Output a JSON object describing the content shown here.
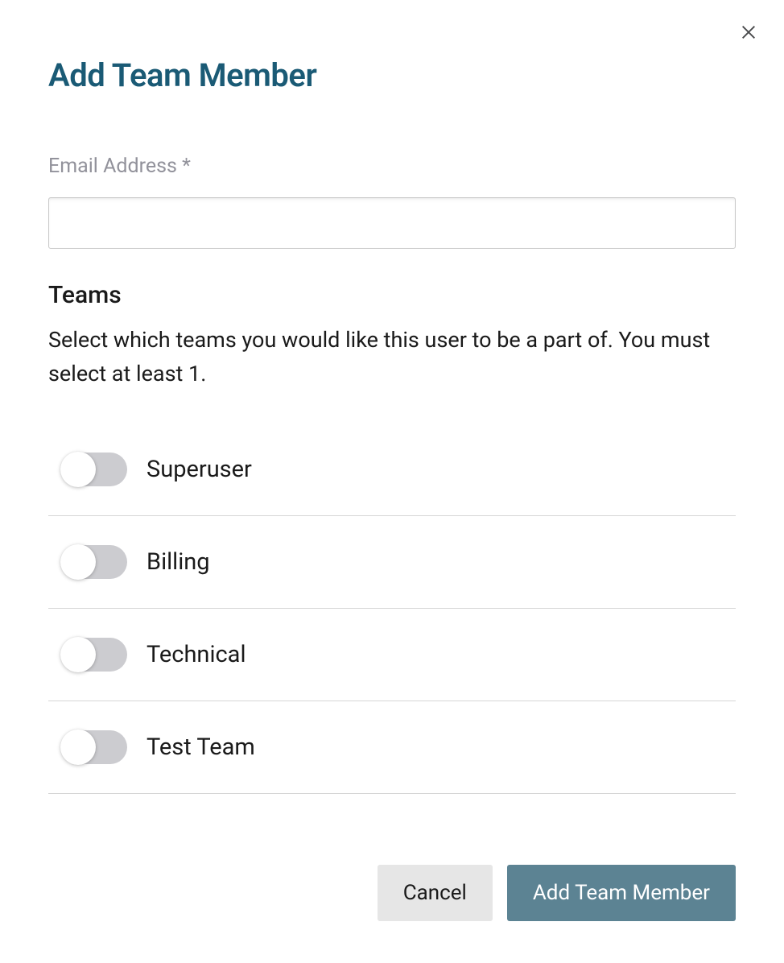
{
  "dialog": {
    "title": "Add Team Member",
    "email_label": "Email Address *",
    "email_value": "",
    "teams_heading": "Teams",
    "teams_description": "Select which teams you would like this user to be a part of. You must select at least 1.",
    "teams": [
      {
        "label": "Superuser",
        "on": false
      },
      {
        "label": "Billing",
        "on": false
      },
      {
        "label": "Technical",
        "on": false
      },
      {
        "label": "Test Team",
        "on": false
      }
    ],
    "cancel_label": "Cancel",
    "submit_label": "Add Team Member"
  }
}
